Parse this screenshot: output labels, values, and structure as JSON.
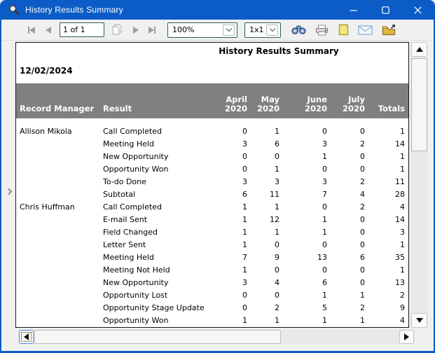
{
  "window": {
    "title": "History Results Summary"
  },
  "toolbar": {
    "page_value": "1 of 1",
    "zoom_value": "100%",
    "layout_value": "1x1",
    "icon_names": [
      "first-page-icon",
      "previous-page-icon",
      "copy-pages-icon",
      "next-page-icon",
      "last-page-icon",
      "find-binoculars-icon",
      "print-icon",
      "export-page-icon",
      "email-envelope-icon",
      "folder-icon"
    ]
  },
  "report": {
    "title": "History Results Summary",
    "date": "12/02/2024",
    "columns": {
      "record_manager": "Record Manager",
      "result": "Result",
      "months": [
        {
          "label": "April",
          "year": "2020"
        },
        {
          "label": "May",
          "year": "2020"
        },
        {
          "label": "June",
          "year": "2020"
        },
        {
          "label": "July",
          "year": "2020"
        }
      ],
      "totals": "Totals"
    },
    "groups": [
      {
        "manager": "Allison Mikola",
        "rows": [
          {
            "result": "Call Completed",
            "values": [
              0,
              1,
              0,
              0,
              1
            ]
          },
          {
            "result": "Meeting Held",
            "values": [
              3,
              6,
              3,
              2,
              14
            ]
          },
          {
            "result": "New Opportunity",
            "values": [
              0,
              0,
              1,
              0,
              1
            ]
          },
          {
            "result": "Opportunity Won",
            "values": [
              0,
              1,
              0,
              0,
              1
            ]
          },
          {
            "result": "To-do Done",
            "values": [
              3,
              3,
              3,
              2,
              11
            ]
          },
          {
            "result": "Subtotal",
            "values": [
              6,
              11,
              7,
              4,
              28
            ]
          }
        ]
      },
      {
        "manager": "Chris Huffman",
        "rows": [
          {
            "result": "Call Completed",
            "values": [
              1,
              1,
              0,
              2,
              4
            ]
          },
          {
            "result": "E-mail Sent",
            "values": [
              1,
              12,
              1,
              0,
              14
            ]
          },
          {
            "result": "Field Changed",
            "values": [
              1,
              1,
              1,
              0,
              3
            ]
          },
          {
            "result": "Letter Sent",
            "values": [
              1,
              0,
              0,
              0,
              1
            ]
          },
          {
            "result": "Meeting Held",
            "values": [
              7,
              9,
              13,
              6,
              35
            ]
          },
          {
            "result": "Meeting Not Held",
            "values": [
              1,
              0,
              0,
              0,
              1
            ]
          },
          {
            "result": "New Opportunity",
            "values": [
              3,
              4,
              6,
              0,
              13
            ]
          },
          {
            "result": "Opportunity Lost",
            "values": [
              0,
              0,
              1,
              1,
              2
            ]
          },
          {
            "result": "Opportunity Stage Update",
            "values": [
              0,
              2,
              5,
              2,
              9
            ]
          },
          {
            "result": "Opportunity Won",
            "values": [
              1,
              1,
              1,
              1,
              4
            ]
          }
        ]
      }
    ]
  },
  "colors": {
    "titlebar_blue": "#0b5cc6",
    "header_band_gray": "#808080",
    "combo_border_teal": "#2a5f55",
    "page_background": "#ffffff"
  }
}
